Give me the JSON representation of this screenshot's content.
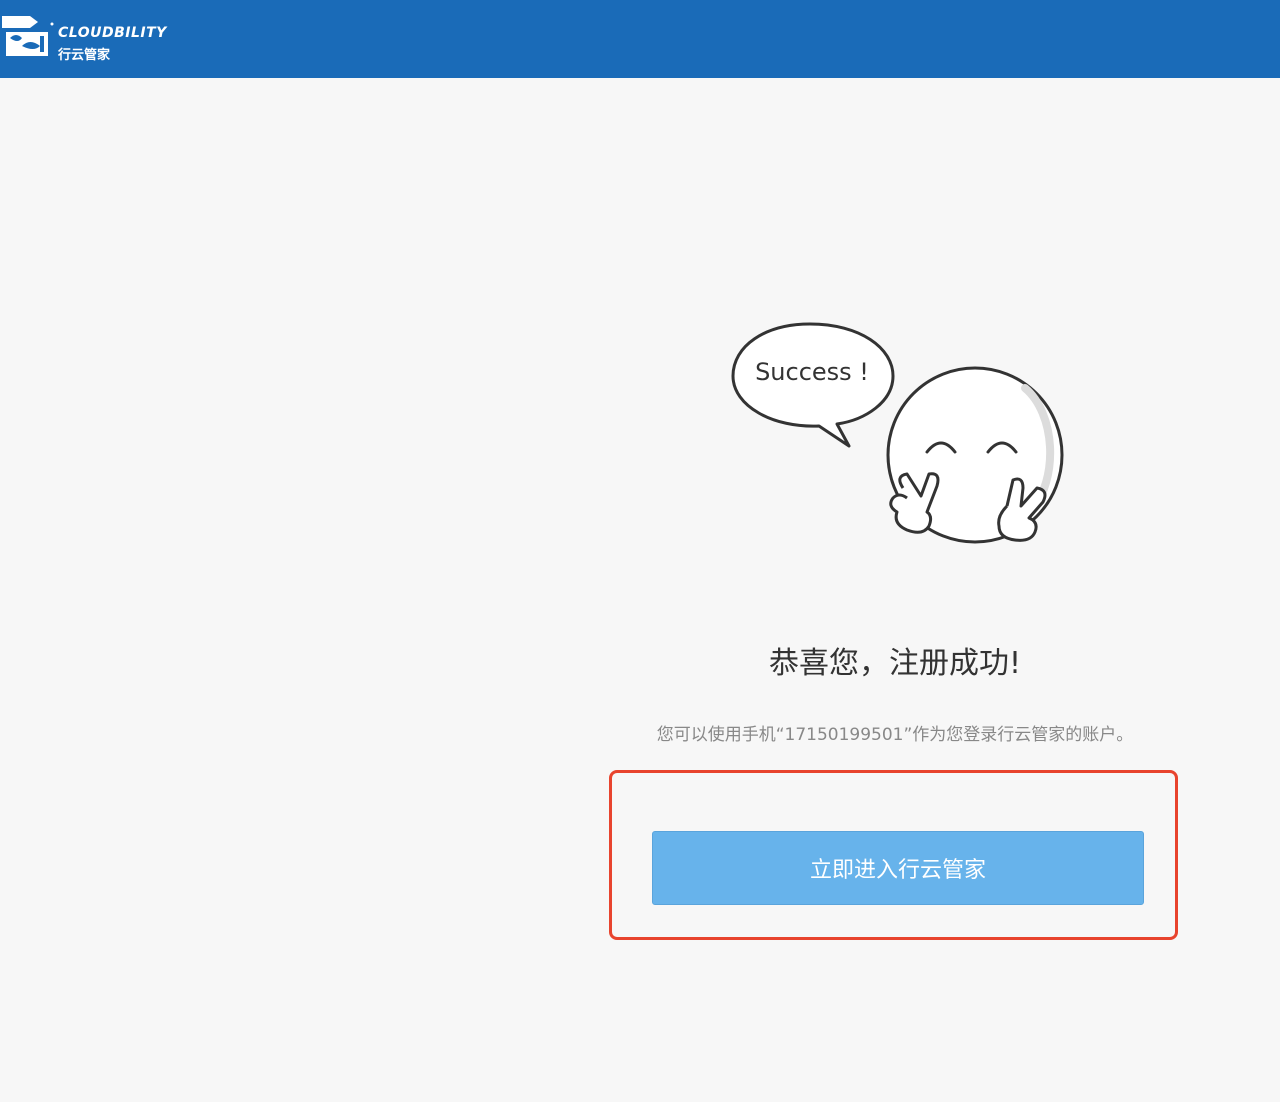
{
  "header": {
    "brand_en": "CLOUDBILITY",
    "brand_cn": "行云管家",
    "logo_icon": "cloud-logo-icon",
    "background_color": "#1a6bb8"
  },
  "illustration": {
    "bubble_text": "Success !",
    "icon": "smiley-victory-icon"
  },
  "main": {
    "title": "恭喜您，注册成功!",
    "subtitle": "您可以使用手机“17150199501”作为您登录行云管家的账户。",
    "enter_button_label": "立即进入行云管家",
    "button_color": "#67b3eb",
    "highlight_color": "#e8442e"
  }
}
